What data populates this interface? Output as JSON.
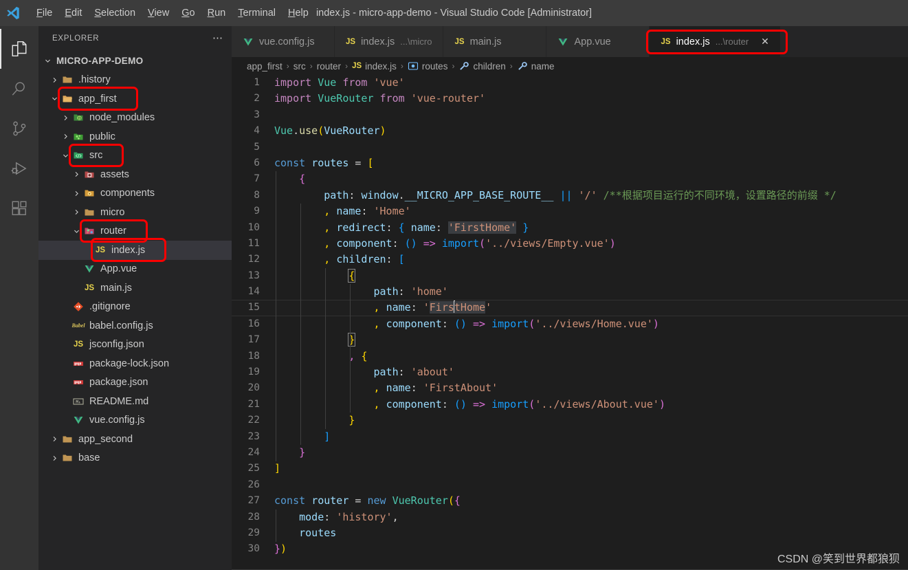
{
  "window": {
    "title": "index.js - micro-app-demo - Visual Studio Code [Administrator]",
    "logo_icon": "vscode-logo-icon"
  },
  "menubar": {
    "items": [
      {
        "label": "File",
        "mnemonic": "F"
      },
      {
        "label": "Edit",
        "mnemonic": "E"
      },
      {
        "label": "Selection",
        "mnemonic": "S"
      },
      {
        "label": "View",
        "mnemonic": "V"
      },
      {
        "label": "Go",
        "mnemonic": "G"
      },
      {
        "label": "Run",
        "mnemonic": "R"
      },
      {
        "label": "Terminal",
        "mnemonic": "T"
      },
      {
        "label": "Help",
        "mnemonic": "H"
      }
    ]
  },
  "activitybar": {
    "items": [
      {
        "name": "explorer-icon",
        "active": true
      },
      {
        "name": "search-icon",
        "active": false
      },
      {
        "name": "source-control-icon",
        "active": false
      },
      {
        "name": "run-debug-icon",
        "active": false
      },
      {
        "name": "extensions-icon",
        "active": false
      }
    ]
  },
  "sidebar": {
    "title": "EXPLORER",
    "more_label": "⋯",
    "root": "MICRO-APP-DEMO",
    "items": [
      {
        "label": ".history",
        "indent": 1,
        "twisty": ">",
        "icon": "folder-icon",
        "highlighted": false,
        "selected": false
      },
      {
        "label": "app_first",
        "indent": 1,
        "twisty": "v",
        "icon": "folder-open-icon",
        "highlighted": true,
        "selected": false
      },
      {
        "label": "node_modules",
        "indent": 2,
        "twisty": ">",
        "icon": "node-folder-icon",
        "highlighted": false,
        "selected": false
      },
      {
        "label": "public",
        "indent": 2,
        "twisty": ">",
        "icon": "public-folder-icon",
        "highlighted": false,
        "selected": false
      },
      {
        "label": "src",
        "indent": 2,
        "twisty": "v",
        "icon": "src-folder-icon",
        "highlighted": true,
        "selected": false
      },
      {
        "label": "assets",
        "indent": 3,
        "twisty": ">",
        "icon": "assets-folder-icon",
        "highlighted": false,
        "selected": false
      },
      {
        "label": "components",
        "indent": 3,
        "twisty": ">",
        "icon": "components-folder-icon",
        "highlighted": false,
        "selected": false
      },
      {
        "label": "micro",
        "indent": 3,
        "twisty": ">",
        "icon": "folder-icon",
        "highlighted": false,
        "selected": false
      },
      {
        "label": "router",
        "indent": 3,
        "twisty": "v",
        "icon": "router-folder-icon",
        "highlighted": true,
        "selected": false
      },
      {
        "label": "index.js",
        "indent": 4,
        "twisty": "",
        "icon": "js-file-icon",
        "highlighted": true,
        "selected": true
      },
      {
        "label": "App.vue",
        "indent": 3,
        "twisty": "",
        "icon": "vue-file-icon",
        "highlighted": false,
        "selected": false
      },
      {
        "label": "main.js",
        "indent": 3,
        "twisty": "",
        "icon": "js-file-icon",
        "highlighted": false,
        "selected": false
      },
      {
        "label": ".gitignore",
        "indent": 2,
        "twisty": "",
        "icon": "git-file-icon",
        "highlighted": false,
        "selected": false
      },
      {
        "label": "babel.config.js",
        "indent": 2,
        "twisty": "",
        "icon": "babel-file-icon",
        "highlighted": false,
        "selected": false
      },
      {
        "label": "jsconfig.json",
        "indent": 2,
        "twisty": "",
        "icon": "jsconfig-file-icon",
        "highlighted": false,
        "selected": false
      },
      {
        "label": "package-lock.json",
        "indent": 2,
        "twisty": "",
        "icon": "npm-file-icon",
        "highlighted": false,
        "selected": false
      },
      {
        "label": "package.json",
        "indent": 2,
        "twisty": "",
        "icon": "npm-file-icon",
        "highlighted": false,
        "selected": false
      },
      {
        "label": "README.md",
        "indent": 2,
        "twisty": "",
        "icon": "markdown-file-icon",
        "highlighted": false,
        "selected": false
      },
      {
        "label": "vue.config.js",
        "indent": 2,
        "twisty": "",
        "icon": "vue-file-icon",
        "highlighted": false,
        "selected": false
      },
      {
        "label": "app_second",
        "indent": 1,
        "twisty": ">",
        "icon": "folder-icon",
        "highlighted": false,
        "selected": false
      },
      {
        "label": "base",
        "indent": 1,
        "twisty": ">",
        "icon": "folder-icon",
        "highlighted": false,
        "selected": false
      }
    ]
  },
  "tabs": [
    {
      "label": "vue.config.js",
      "suffix": "",
      "icon": "vue-file-icon",
      "active": false,
      "closable": false,
      "highlighted": false
    },
    {
      "label": "index.js",
      "suffix": "...\\micro",
      "icon": "js-file-icon",
      "active": false,
      "closable": false,
      "highlighted": false
    },
    {
      "label": "main.js",
      "suffix": "",
      "icon": "js-file-icon",
      "active": false,
      "closable": false,
      "highlighted": false
    },
    {
      "label": "App.vue",
      "suffix": "",
      "icon": "vue-file-icon",
      "active": false,
      "closable": false,
      "highlighted": false
    },
    {
      "label": "index.js",
      "suffix": "...\\router",
      "icon": "js-file-icon",
      "active": true,
      "closable": true,
      "close_label": "✕",
      "highlighted": true
    }
  ],
  "breadcrumbs": [
    {
      "label": "app_first",
      "icon": ""
    },
    {
      "label": "src",
      "icon": ""
    },
    {
      "label": "router",
      "icon": ""
    },
    {
      "label": "index.js",
      "icon": "js-file-icon"
    },
    {
      "label": "routes",
      "icon": "array-symbol-icon"
    },
    {
      "label": "children",
      "icon": "property-symbol-icon"
    },
    {
      "label": "name",
      "icon": "property-symbol-icon"
    }
  ],
  "breadcrumb_separator": "›",
  "editor": {
    "active_line": 15,
    "file": "index.js",
    "line_numbers": [
      1,
      2,
      3,
      4,
      5,
      6,
      7,
      8,
      9,
      10,
      11,
      12,
      13,
      14,
      15,
      16,
      17,
      18,
      19,
      20,
      21,
      22,
      23,
      24,
      25,
      26,
      27,
      28,
      29,
      30
    ],
    "lines_plain": [
      "import Vue from 'vue'",
      "import VueRouter from 'vue-router'",
      "",
      "Vue.use(VueRouter)",
      "",
      "const routes = [",
      "    {",
      "        path: window.__MICRO_APP_BASE_ROUTE__ || '/' /**根据项目运行的不同环境，设置路径的前缀 */",
      "        , name: 'Home'",
      "        , redirect: { name: 'FirstHome' }",
      "        , component: () => import('../views/Empty.vue')",
      "        , children: [",
      "            {",
      "                path: 'home'",
      "                , name: 'FirstHome'",
      "                , component: () => import('../views/Home.vue')",
      "            }",
      "            , {",
      "                path: 'about'",
      "                , name: 'FirstAbout'",
      "                , component: () => import('../views/About.vue')",
      "            }",
      "        ]",
      "    }",
      "]",
      "",
      "const router = new VueRouter({",
      "    mode: 'history',",
      "    routes",
      "})"
    ],
    "chinese_comment": "/**根据项目运行的不同环境，设置路径的前缀 */"
  },
  "watermark": "CSDN @笑到世界都狼狈",
  "colors": {
    "accent_red": "#fb0000",
    "editor_bg": "#1e1e1e",
    "sidebar_bg": "#252526",
    "titlebar_bg": "#3c3c3c",
    "activitybar_bg": "#333333",
    "selection_bg": "#37373d"
  }
}
